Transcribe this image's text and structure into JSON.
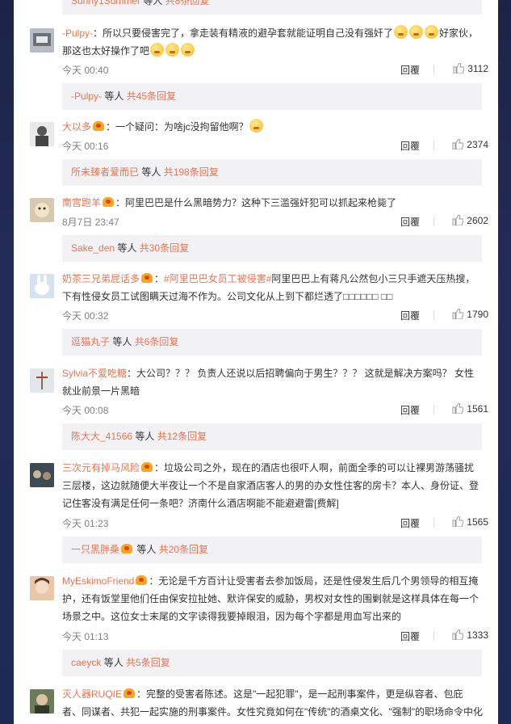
{
  "top_sub": {
    "user": "Sunny1Summer",
    "text": " 等人 ",
    "count": "共8条回复"
  },
  "reply_label": "回覆",
  "comments": [
    {
      "user": "-Pulpy-",
      "vip": false,
      "text_a": "：所以只要侵害完了，拿走装有精液的避孕套就能证明自己没有强奸了",
      "text_b": "好家伙，",
      "text_c": "那这也太好操作了吧",
      "time": "今天 00:40",
      "likes": "3112",
      "sub_user": "-Pulpy-",
      "sub_mid": " 等人 ",
      "sub_count": "共45条回复"
    },
    {
      "user": "大以多",
      "vip": true,
      "text_a": "：一个疑问：为啥jc没拘留他啊？",
      "time": "今天 00:16",
      "likes": "2374",
      "sub_user": "所未臻者爱而已",
      "sub_mid": " 等人 ",
      "sub_count": "共198条回复"
    },
    {
      "user": "南宫跑羊",
      "vip": true,
      "text_a": "：阿里巴巴是什么黑暗势力？这种下三滥强奸犯可以抓起来枪毙了",
      "time": "8月7日 23:47",
      "likes": "2602",
      "sub_user": "Sake_den",
      "sub_mid": " 等人 ",
      "sub_count": "共30条回复"
    },
    {
      "user": "奶茶三兄弟屁话多",
      "vip": true,
      "text_a": "：",
      "hashtag": "#阿里巴巴女员工被侵害#",
      "text_b": "阿里巴巴上有蒋凡公然包小三只手遮天压热搜，",
      "text_c": "下有性侵女员工试图瞒天过海不作为。公司文化从上到下都烂透了□□□□□□  □□",
      "time": "今天 00:32",
      "likes": "1790",
      "sub_user": "逗猫丸子",
      "sub_mid": " 等人 ",
      "sub_count": "共6条回复"
    },
    {
      "user": "Sylvia不爱吃糖",
      "vip": false,
      "text_a": "：大公司？？？ 负责人还说以后招聘偏向于男生？？？ 这就是解决方案吗？ 女性",
      "text_b": "就业前景一片黑暗",
      "time": "今天 00:08",
      "likes": "1561",
      "sub_user": "陈大大_41566",
      "sub_mid": " 等人 ",
      "sub_count": "共12条回复"
    },
    {
      "user": "三次元有掉马风险",
      "vip": true,
      "text_a": "：垃圾公司之外，现在的酒店也很吓人啊，前面全季的可以让裸男游荡骚扰",
      "text_b": "三层楼，这边就随便大半夜让一个不是自家酒店客人的男的办女性住客的房卡？本人、身份证、登",
      "text_c": "记住客没有满足任何一条吧？济南什么酒店啊能不能避避雷[费解]",
      "time": "今天 01:23",
      "likes": "1565",
      "sub_user": "一只黑胖桑",
      "sub_mid": " 等人 ",
      "sub_count": "共20条回复"
    },
    {
      "user": "MyEskimoFriend",
      "vip": true,
      "text_a": "：无论是千方百计让受害者去参加饭局，还是性侵发生后几个男领导的相互掩",
      "text_b": "护，还有饭堂里他们任由保安拉扯她、默许保安的威胁，男权对女性的围剿就是这样具体在每一个",
      "text_c": "场景之中。这位女士末尾的文字读得我要掉眼泪，因为每个字都是用血写出来的",
      "time": "今天 01:13",
      "likes": "1333",
      "sub_user": "caeyck",
      "sub_mid": " 等人 ",
      "sub_count": "共5条回复"
    },
    {
      "user": "灭人器RUQIE",
      "vip": true,
      "text_a": "：完整的受害者陈述。这是\"一起犯罪\"，是一起刑事案件，更是纵容者、包庇",
      "text_b": "者、同谋者、共犯一起实施的刑事案件。女性究竟如何在\"传统\"的酒桌文化、\"强制\"的职场命令中化"
    }
  ]
}
